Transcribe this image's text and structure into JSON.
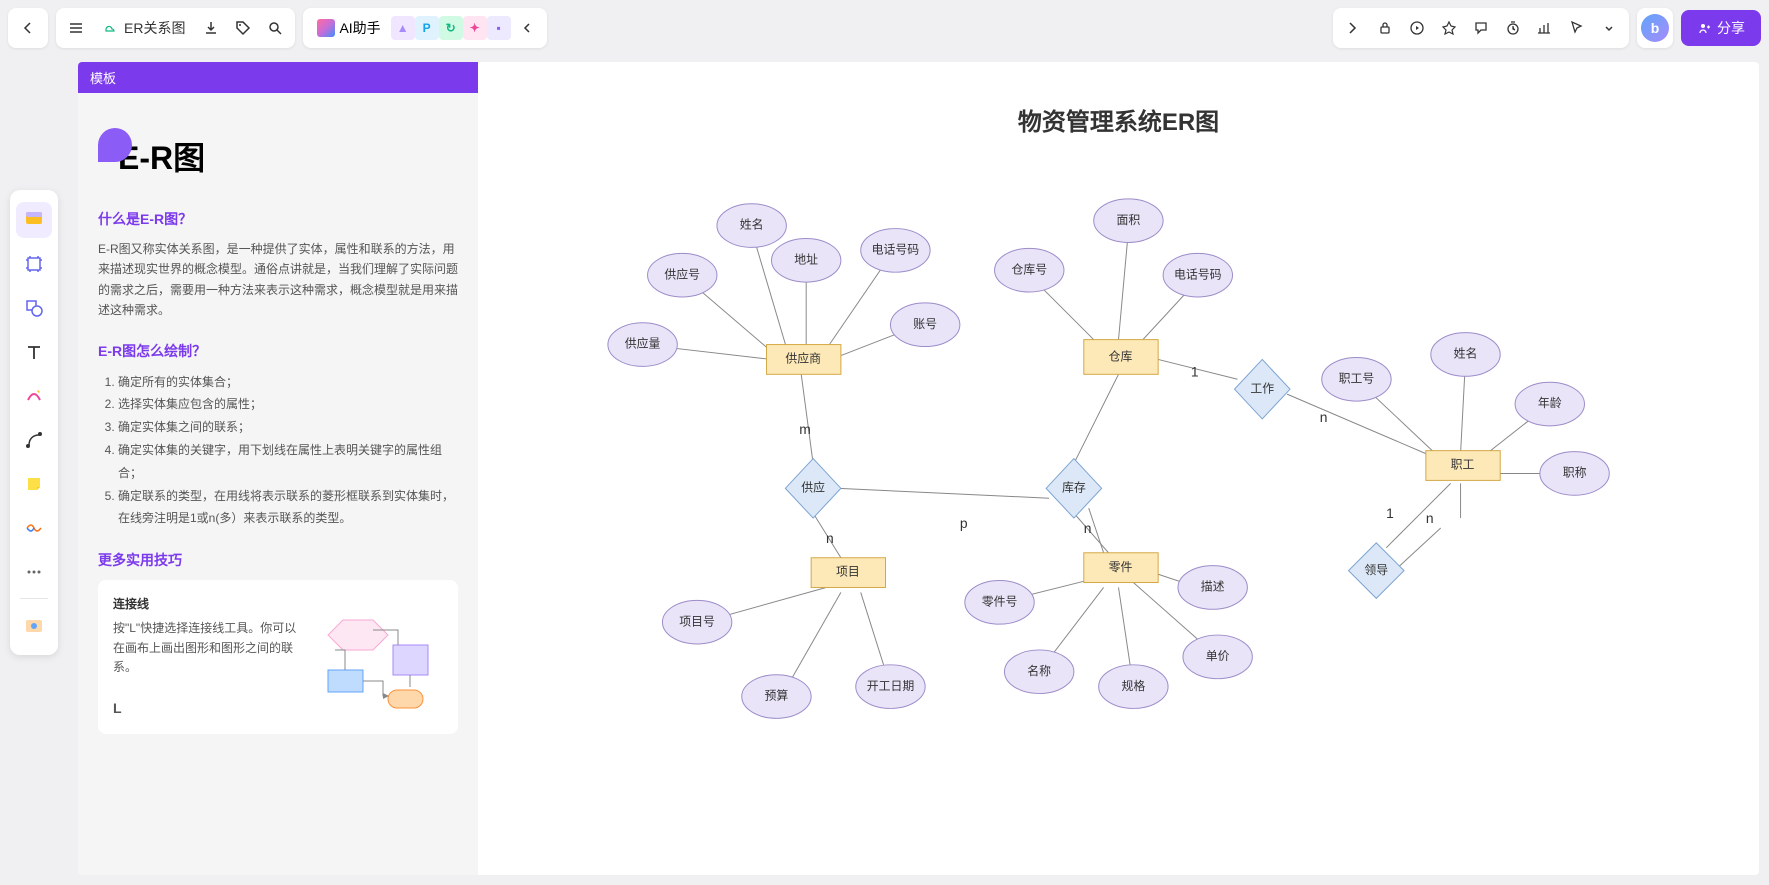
{
  "header": {
    "doc_title": "ER关系图",
    "ai_label": "AI助手",
    "share_label": "分享"
  },
  "template": {
    "badge": "模板",
    "title": "E-R图",
    "q1_title": "什么是E-R图？",
    "q1_body": "E-R图又称实体关系图，是一种提供了实体，属性和联系的方法，用来描述现实世界的概念模型。通俗点讲就是，当我们理解了实际问题的需求之后，需要用一种方法来表示这种需求，概念模型就是用来描述这种需求。",
    "q2_title": "E-R图怎么绘制？",
    "steps": [
      "确定所有的实体集合；",
      "选择实体集应包含的属性；",
      "确定实体集之间的联系；",
      "确定实体集的关键字，用下划线在属性上表明关键字的属性组合；",
      "确定联系的类型，在用线将表示联系的菱形框联系到实体集时，在线旁注明是1或n(多）来表示联系的类型。"
    ],
    "tips_title": "更多实用技巧",
    "tip_card_title": "连接线",
    "tip_card_body": "按\"L\"快捷选择连接线工具。你可以在画布上画出图形和图形之间的联系。",
    "tip_key": "L"
  },
  "diagram": {
    "title": "物资管理系统ER图",
    "entities": {
      "supplier": "供应商",
      "warehouse": "仓库",
      "employee": "职工",
      "project": "项目",
      "part": "零件"
    },
    "relationships": {
      "supply": "供应",
      "work": "工作",
      "stock": "库存",
      "lead": "领导"
    },
    "attributes": {
      "supplier": [
        "供应量",
        "供应号",
        "姓名",
        "地址",
        "电话号码",
        "账号"
      ],
      "warehouse": [
        "仓库号",
        "面积",
        "电话号码"
      ],
      "employee": [
        "职工号",
        "姓名",
        "年龄",
        "职称"
      ],
      "project": [
        "项目号",
        "预算",
        "开工日期"
      ],
      "part": [
        "零件号",
        "名称",
        "规格",
        "单价",
        "描述"
      ]
    },
    "cardinalities": {
      "m": "m",
      "n": "n",
      "p": "p",
      "one": "1"
    }
  }
}
